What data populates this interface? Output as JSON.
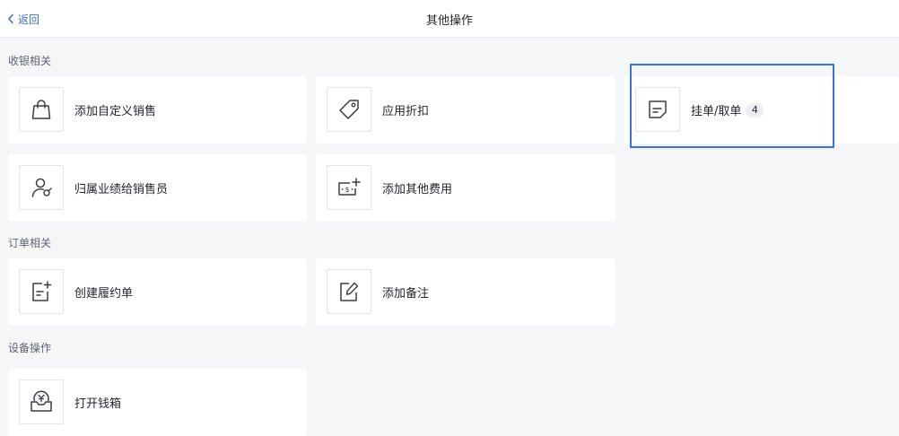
{
  "header": {
    "back_label": "返回",
    "title": "其他操作"
  },
  "sections": {
    "cashier": {
      "title": "收银相关",
      "items": [
        {
          "label": "添加自定义销售",
          "icon": "shopping-bag-icon"
        },
        {
          "label": "应用折扣",
          "icon": "price-tag-icon"
        },
        {
          "label": "挂单/取单",
          "icon": "note-icon",
          "badge": "4"
        },
        {
          "label": "归属业绩给销售员",
          "icon": "user-badge-icon"
        },
        {
          "label": "添加其他费用",
          "icon": "cash-plus-icon"
        }
      ]
    },
    "order": {
      "title": "订单相关",
      "items": [
        {
          "label": "创建履约单",
          "icon": "document-add-icon"
        },
        {
          "label": "添加备注",
          "icon": "edit-note-icon"
        }
      ]
    },
    "device": {
      "title": "设备操作",
      "items": [
        {
          "label": "打开钱箱",
          "icon": "cash-drawer-icon"
        }
      ]
    }
  },
  "colors": {
    "accent": "#3a6fd8",
    "highlight_border": "#3a72e3",
    "background": "#f5f6f8",
    "card": "#ffffff"
  }
}
